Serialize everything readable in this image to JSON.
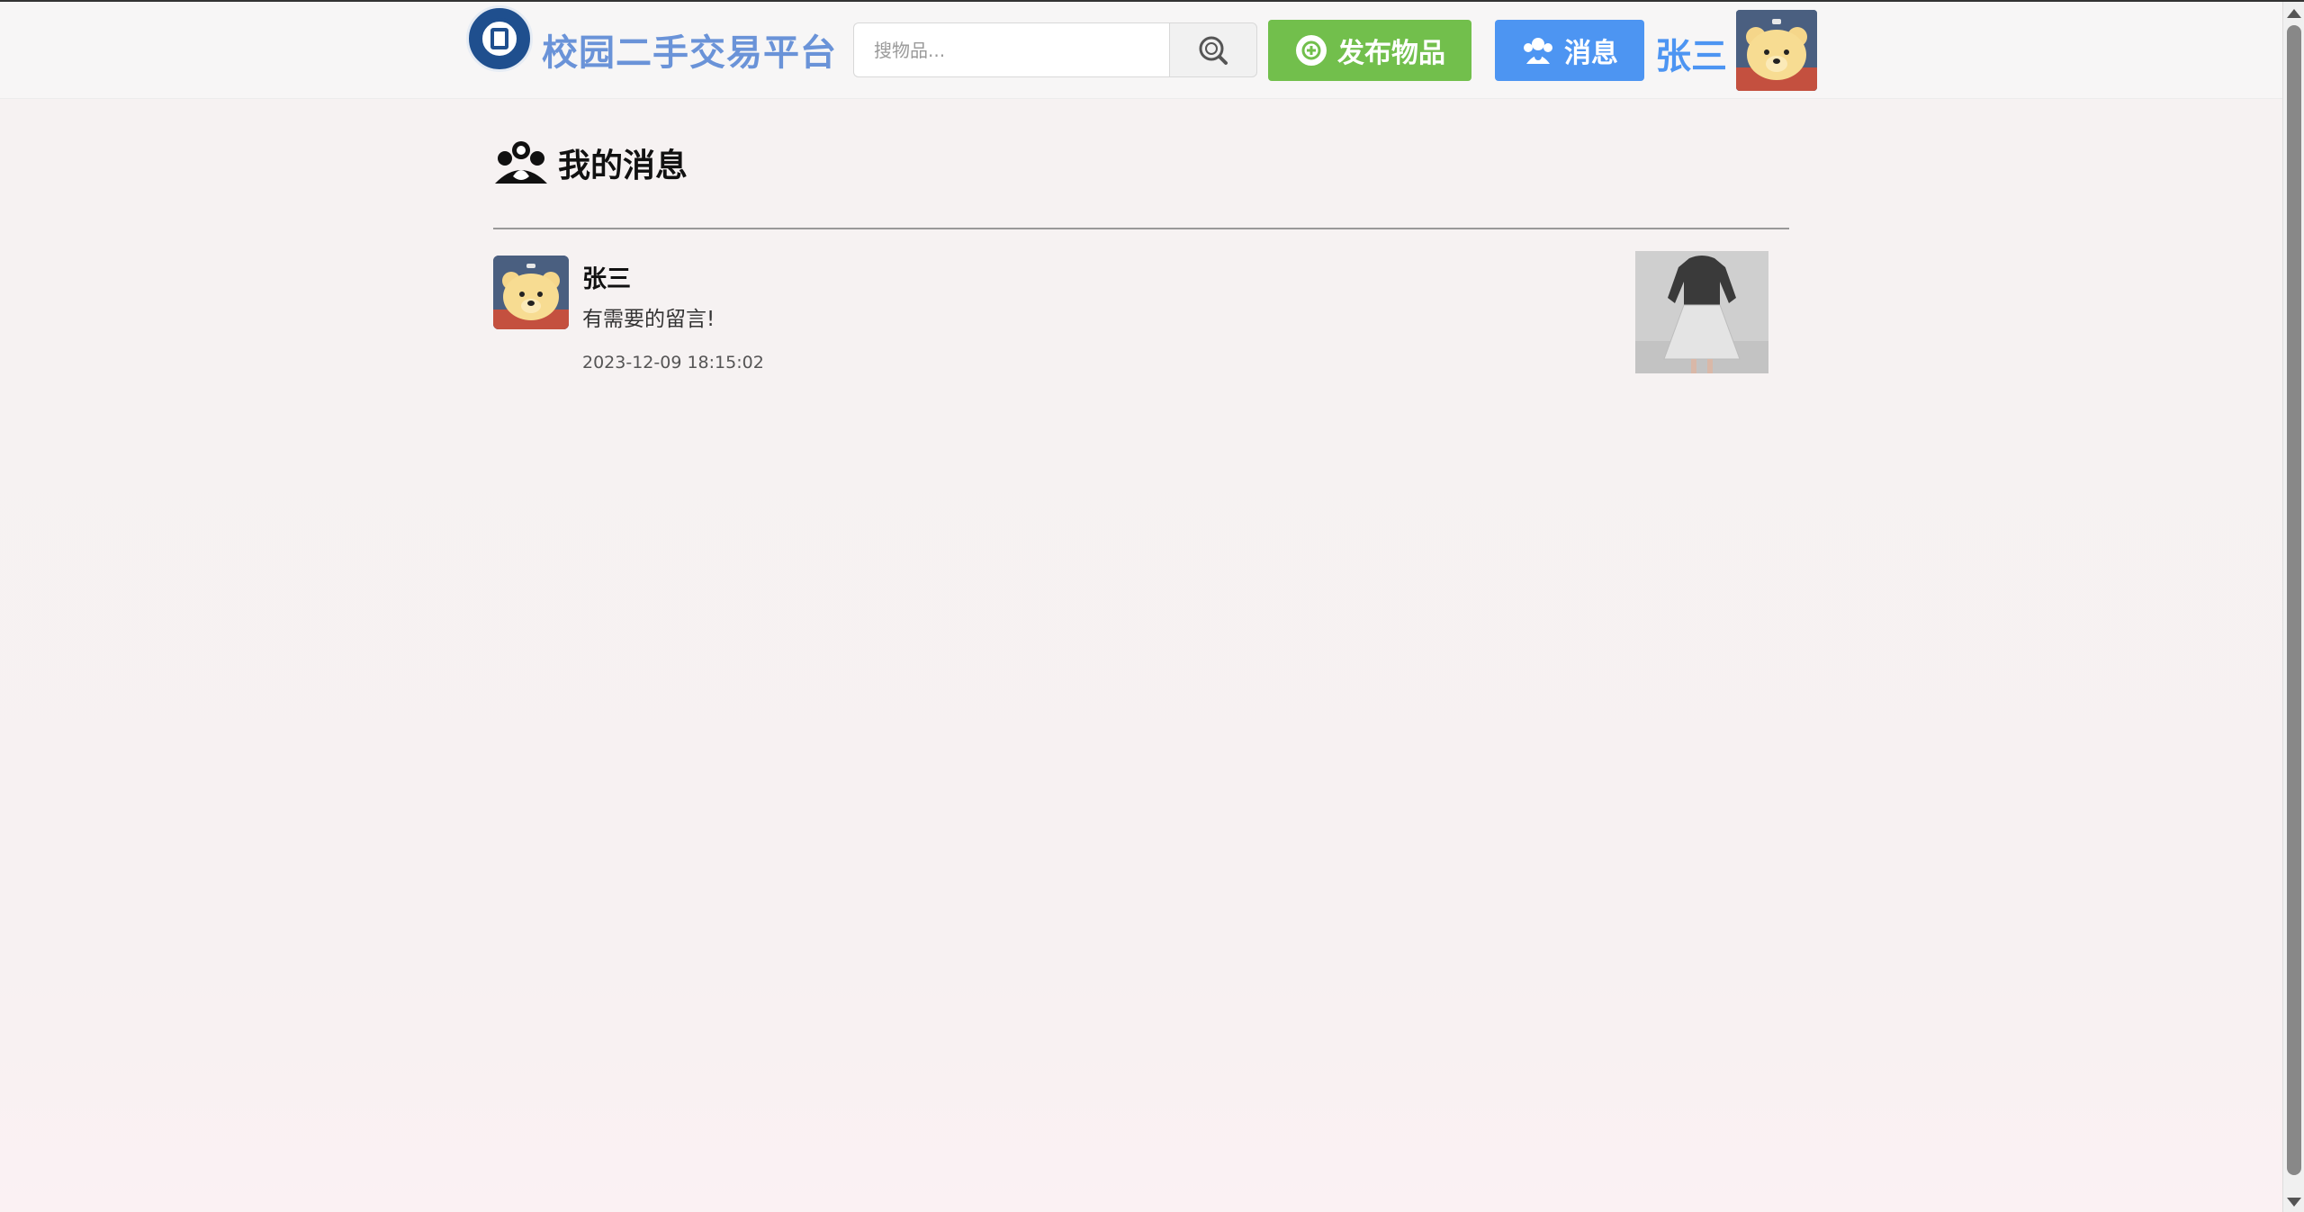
{
  "header": {
    "site_title": "校园二手交易平台",
    "search": {
      "placeholder": "搜物品...",
      "value": ""
    },
    "publish_label": "发布物品",
    "messages_label": "消息",
    "user_name": "张三"
  },
  "main": {
    "section_title": "我的消息",
    "messages": [
      {
        "sender": "张三",
        "text": "有需要的留言!",
        "time": "2023-12-09 18:15:02"
      }
    ]
  },
  "colors": {
    "title_blue": "#6a93d8",
    "publish_green": "#72bf4c",
    "message_blue": "#4d95f2"
  }
}
